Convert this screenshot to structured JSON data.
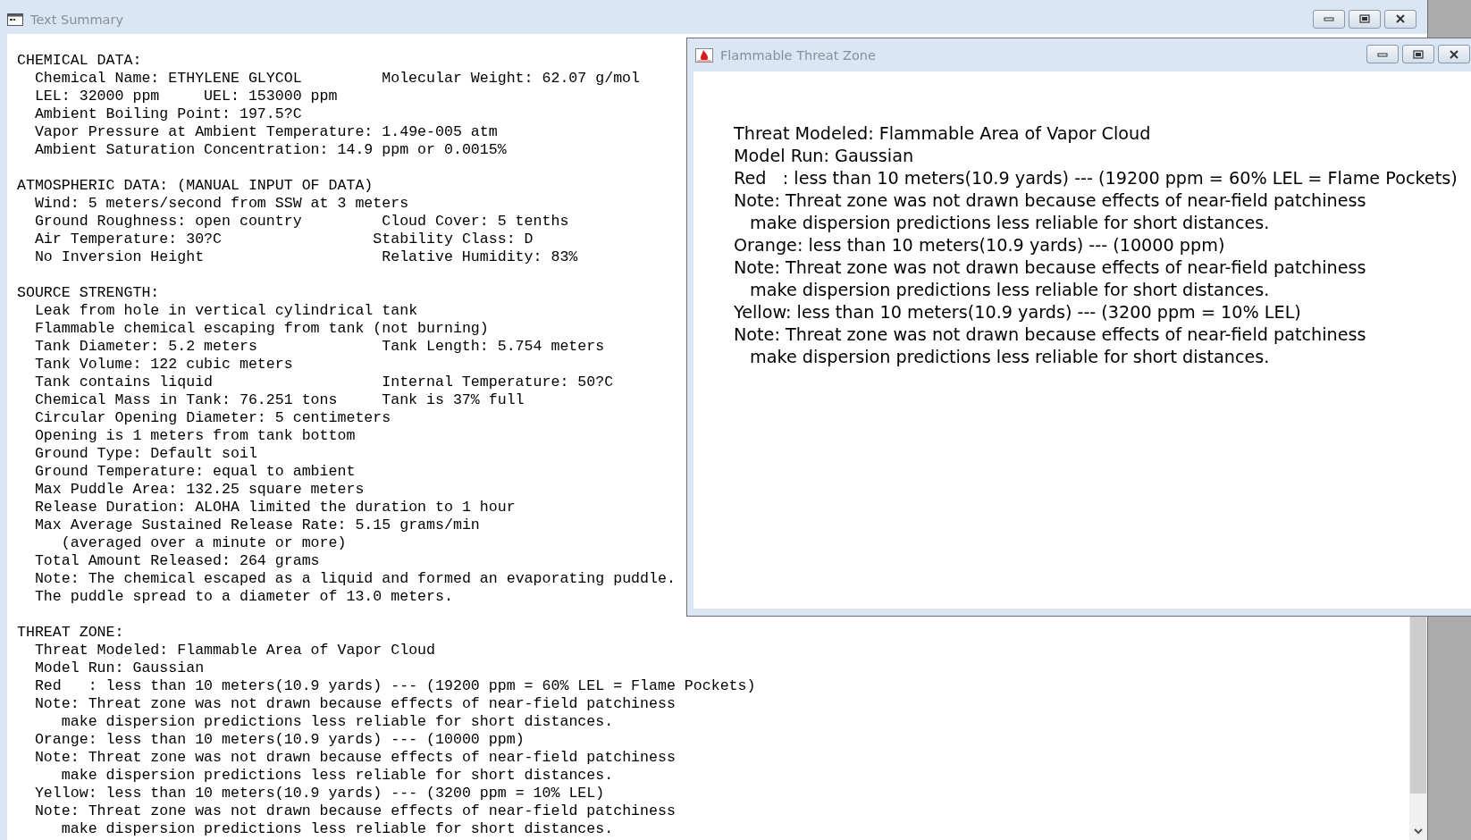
{
  "summary_window": {
    "title": "Text Summary",
    "sections": [
      {
        "heading": "CHEMICAL DATA:",
        "lines": [
          {
            "kind": "pair",
            "text": "Chemical Name: ETHYLENE GLYCOL",
            "right": "Molecular Weight: 62.07 g/mol"
          },
          {
            "kind": "short_pair",
            "text": "LEL: 32000 ppm",
            "right": "UEL: 153000 ppm"
          },
          {
            "kind": "line",
            "text": "Ambient Boiling Point: 197.5?C"
          },
          {
            "kind": "line",
            "text": "Vapor Pressure at Ambient Temperature: 1.49e-005 atm"
          },
          {
            "kind": "line",
            "text": "Ambient Saturation Concentration: 14.9 ppm or 0.0015%"
          }
        ]
      },
      {
        "heading": "ATMOSPHERIC DATA: (MANUAL INPUT OF DATA)",
        "lines": [
          {
            "kind": "line",
            "text": "Wind: 5 meters/second from SSW at 3 meters"
          },
          {
            "kind": "pair",
            "text": "Ground Roughness: open country",
            "right": "Cloud Cover: 5 tenths"
          },
          {
            "kind": "pair_early",
            "text": "Air Temperature: 30?C",
            "right": "Stability Class: D"
          },
          {
            "kind": "pair",
            "text": "No Inversion Height",
            "right": "Relative Humidity: 83%"
          }
        ]
      },
      {
        "heading": "SOURCE STRENGTH:",
        "lines": [
          {
            "kind": "line",
            "text": "Leak from hole in vertical cylindrical tank"
          },
          {
            "kind": "line",
            "text": "Flammable chemical escaping from tank (not burning)"
          },
          {
            "kind": "pair",
            "text": "Tank Diameter: 5.2 meters",
            "right": "Tank Length: 5.754 meters"
          },
          {
            "kind": "line",
            "text": "Tank Volume: 122 cubic meters"
          },
          {
            "kind": "pair",
            "text": "Tank contains liquid",
            "right": "Internal Temperature: 50?C"
          },
          {
            "kind": "pair",
            "text": "Chemical Mass in Tank: 76.251 tons",
            "right": "Tank is 37% full"
          },
          {
            "kind": "line",
            "text": "Circular Opening Diameter: 5 centimeters"
          },
          {
            "kind": "line",
            "text": "Opening is 1 meters from tank bottom"
          },
          {
            "kind": "line",
            "text": "Ground Type: Default soil"
          },
          {
            "kind": "line",
            "text": "Ground Temperature: equal to ambient"
          },
          {
            "kind": "line",
            "text": "Max Puddle Area: 132.25 square meters"
          },
          {
            "kind": "line",
            "text": "Release Duration: ALOHA limited the duration to 1 hour"
          },
          {
            "kind": "line",
            "text": "Max Average Sustained Release Rate: 5.15 grams/min"
          },
          {
            "kind": "continuation",
            "text": "(averaged over a minute or more)"
          },
          {
            "kind": "line",
            "text": "Total Amount Released: 264 grams"
          },
          {
            "kind": "line",
            "text": "Note: The chemical escaped as a liquid and formed an evaporating puddle."
          },
          {
            "kind": "line",
            "text": "The puddle spread to a diameter of 13.0 meters."
          }
        ]
      },
      {
        "heading": "THREAT ZONE:",
        "lines": [
          {
            "kind": "line",
            "text": "Threat Modeled: Flammable Area of Vapor Cloud"
          },
          {
            "kind": "line",
            "text": "Model Run: Gaussian"
          },
          {
            "kind": "line",
            "text": "Red   : less than 10 meters(10.9 yards) --- (19200 ppm = 60% LEL = Flame Pockets)"
          },
          {
            "kind": "line",
            "text": "Note: Threat zone was not drawn because effects of near-field patchiness"
          },
          {
            "kind": "continuation",
            "text": "make dispersion predictions less reliable for short distances."
          },
          {
            "kind": "line",
            "text": "Orange: less than 10 meters(10.9 yards) --- (10000 ppm)"
          },
          {
            "kind": "line",
            "text": "Note: Threat zone was not drawn because effects of near-field patchiness"
          },
          {
            "kind": "continuation",
            "text": "make dispersion predictions less reliable for short distances."
          },
          {
            "kind": "line",
            "text": "Yellow: less than 10 meters(10.9 yards) --- (3200 ppm = 10% LEL)"
          },
          {
            "kind": "line",
            "text": "Note: Threat zone was not drawn because effects of near-field patchiness"
          },
          {
            "kind": "continuation",
            "text": "make dispersion predictions less reliable for short distances."
          }
        ]
      }
    ]
  },
  "threat_window": {
    "title": "Flammable Threat Zone",
    "lines": [
      {
        "kind": "line",
        "text": "Threat Modeled: Flammable Area of Vapor Cloud"
      },
      {
        "kind": "line",
        "text": "Model Run: Gaussian"
      },
      {
        "kind": "line",
        "text": "Red   : less than 10 meters(10.9 yards) --- (19200 ppm = 60% LEL = Flame Pockets)"
      },
      {
        "kind": "line",
        "text": "Note: Threat zone was not drawn because effects of near-field patchiness"
      },
      {
        "kind": "continuation",
        "text": "make dispersion predictions less reliable for short distances."
      },
      {
        "kind": "line",
        "text": "Orange: less than 10 meters(10.9 yards) --- (10000 ppm)"
      },
      {
        "kind": "line",
        "text": "Note: Threat zone was not drawn because effects of near-field patchiness"
      },
      {
        "kind": "continuation",
        "text": "make dispersion predictions less reliable for short distances."
      },
      {
        "kind": "line",
        "text": "Yellow: less than 10 meters(10.9 yards) --- (3200 ppm = 10% LEL)"
      },
      {
        "kind": "line",
        "text": "Note: Threat zone was not drawn because effects of near-field patchiness"
      },
      {
        "kind": "continuation",
        "text": "make dispersion predictions less reliable for short distances."
      }
    ]
  }
}
